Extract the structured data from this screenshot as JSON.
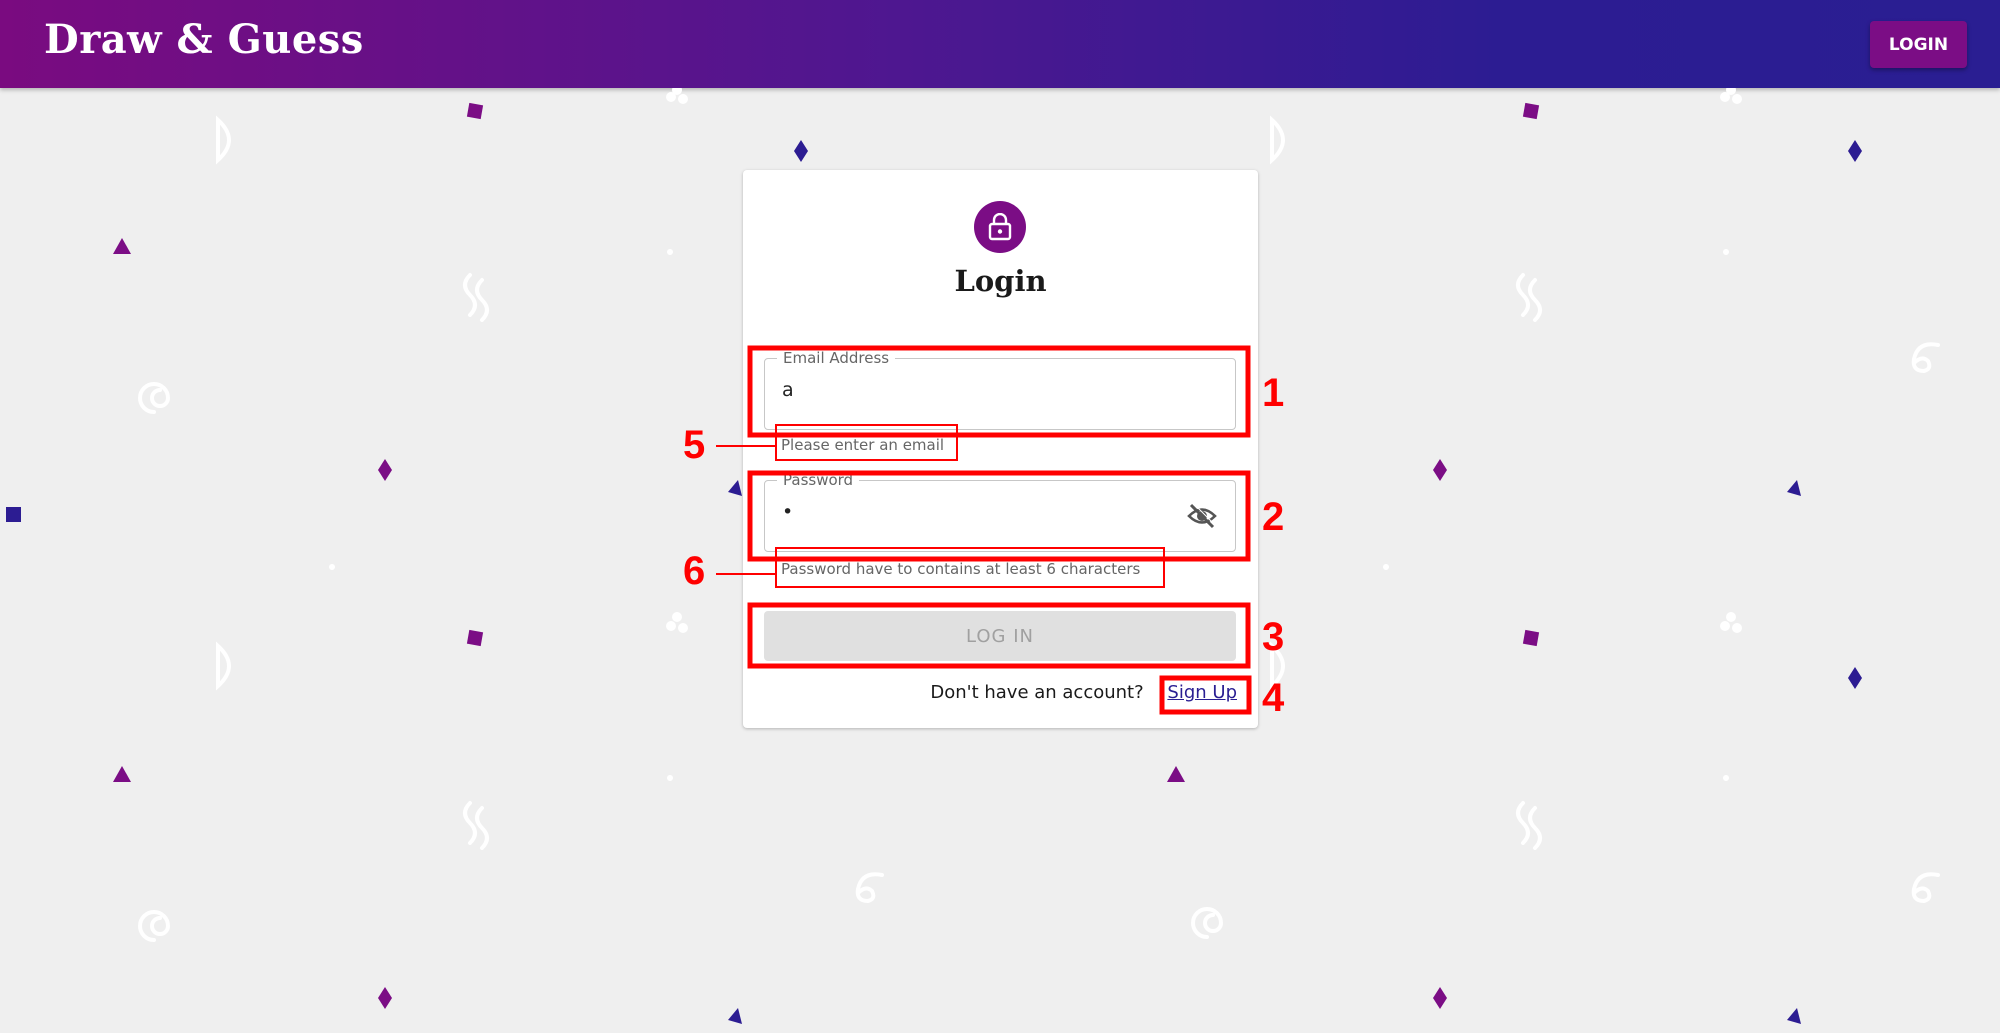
{
  "header": {
    "brand": "Draw & Guess",
    "login_button": "LOGIN",
    "background_color_start": "#7a0b80",
    "background_color_end": "#2a1e92"
  },
  "card": {
    "icon": "lock-icon",
    "title": "Login",
    "email": {
      "label": "Email Address",
      "value": "a",
      "helper": "Please enter an email"
    },
    "password": {
      "label": "Password",
      "value": "•",
      "helper": "Password have to contains at least 6 characters",
      "visibility_icon": "eye-off-icon"
    },
    "login_button": "LOG IN",
    "signup_prompt": "Don't have an account?",
    "signup_link": "Sign Up"
  },
  "annotations": [
    "1",
    "2",
    "3",
    "4",
    "5",
    "6"
  ],
  "colors": {
    "accent": "#7b0d85",
    "annotation": "#ff0000",
    "disabled_button": "#e0e0e0"
  }
}
